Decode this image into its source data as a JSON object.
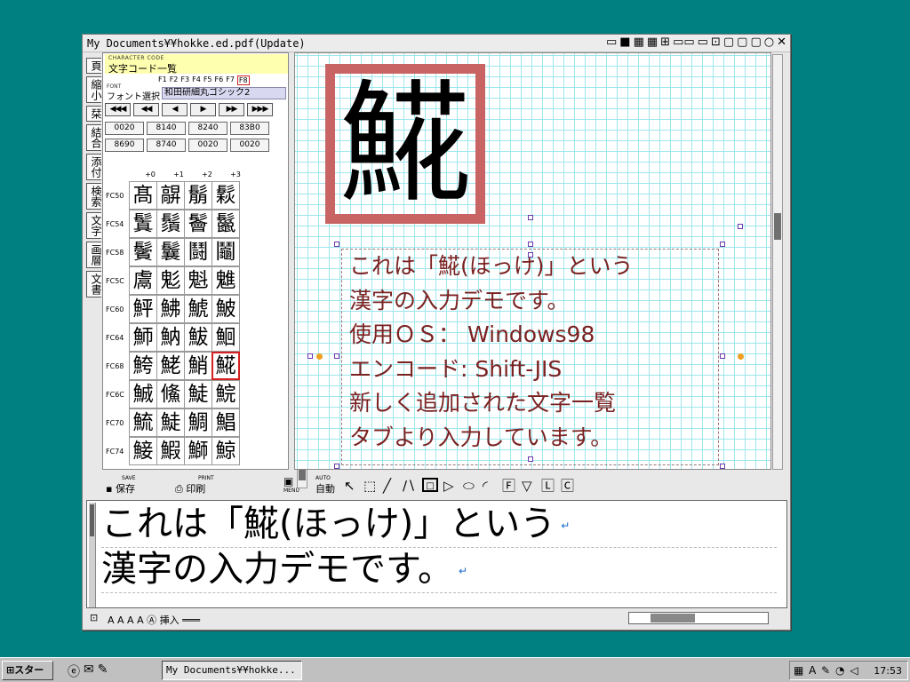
{
  "window": {
    "title": "My Documents¥¥hokke.ed.pdf(Update)",
    "title_icons": [
      "▭",
      "■",
      "▦",
      "▦",
      "⊞",
      "▭▭",
      "▭",
      "⊡",
      "▢",
      "▢",
      "▢",
      "○",
      "✕"
    ]
  },
  "vtabs": [
    "頁",
    "縮小",
    "栞",
    "結合",
    "添付",
    "検索",
    "文字",
    "画層",
    "文書"
  ],
  "char_panel": {
    "small_title": "CHARACTER CODE",
    "title": "文字コード一覧",
    "fkeys": [
      "F1",
      "F2",
      "F3",
      "F4",
      "F5",
      "F6",
      "F7",
      "F8"
    ],
    "active_fkey": "F8",
    "font_small": "FONT",
    "font_label": "フォント選択",
    "font_value": "和田研細丸ゴシック2",
    "nav": [
      "◀◀◀",
      "◀◀",
      "◀",
      "▶",
      "▶▶",
      "▶▶▶"
    ],
    "codes_row1": [
      "0020",
      "8140",
      "8240",
      "83B0"
    ],
    "codes_row2": [
      "8690",
      "8740",
      "0020",
      "0020"
    ],
    "col_heads": [
      "+0",
      "+1",
      "+2",
      "+3"
    ],
    "rows": [
      {
        "label": "FC50",
        "chars": [
          "髙",
          "髜",
          "鬅",
          "鬏"
        ]
      },
      {
        "label": "FC54",
        "chars": [
          "鬒",
          "鬚",
          "鬠",
          "鬣"
        ]
      },
      {
        "label": "FC58",
        "chars": [
          "鬢",
          "鬤",
          "鬪",
          "鬮"
        ]
      },
      {
        "label": "FC5C",
        "chars": [
          "鬳",
          "鬽",
          "魁",
          "魋"
        ]
      },
      {
        "label": "FC60",
        "chars": [
          "鮃",
          "鮄",
          "鯱",
          "鮍"
        ]
      },
      {
        "label": "FC64",
        "chars": [
          "魳",
          "魶",
          "鮁",
          "鮰"
        ]
      },
      {
        "label": "FC68",
        "chars": [
          "鮬",
          "鮱",
          "鮹",
          "𩸽"
        ]
      },
      {
        "label": "FC6C",
        "chars": [
          "鯎",
          "鯈",
          "鯐",
          "鯇"
        ]
      },
      {
        "label": "FC70",
        "chars": [
          "鯍",
          "鯐",
          "鯛",
          "鯧"
        ]
      },
      {
        "label": "FC74",
        "chars": [
          "鯜",
          "鰕",
          "鰤",
          "鯨"
        ]
      }
    ],
    "selected": {
      "row": 6,
      "col": 3
    }
  },
  "canvas": {
    "big_glyph": "𩸽",
    "text_lines": [
      "これは「𩸽(ほっけ)」という",
      "漢字の入力デモです。",
      "使用ＯＳ： Windows98",
      "エンコード: Shift-JIS",
      "新しく追加された文字一覧",
      "タブより入力しています。"
    ]
  },
  "toolbar": {
    "save_small": "SAVE",
    "save": "保存",
    "print_small": "PRINT",
    "print": "印刷",
    "menu_small": "MENU",
    "auto_small": "AUTO",
    "auto": "自動",
    "tools": [
      "↖",
      "⬚",
      "╱",
      "∕∖",
      "□",
      "▷",
      "⬭",
      "◜",
      "🄵",
      "▽",
      "🄻",
      "🄲"
    ]
  },
  "editor": {
    "lines": [
      "これは「𩸽(ほっけ)」という",
      "漢字の入力デモです。"
    ],
    "return_mark": "↵"
  },
  "status": {
    "text": "A  A  A  A  Ⓐ  挿入  ═══"
  },
  "taskbar": {
    "start": "スタート",
    "task": "My Documents¥¥hokke...",
    "tray": "▦ A ✎ ◔ ◁",
    "clock": "17:53"
  }
}
